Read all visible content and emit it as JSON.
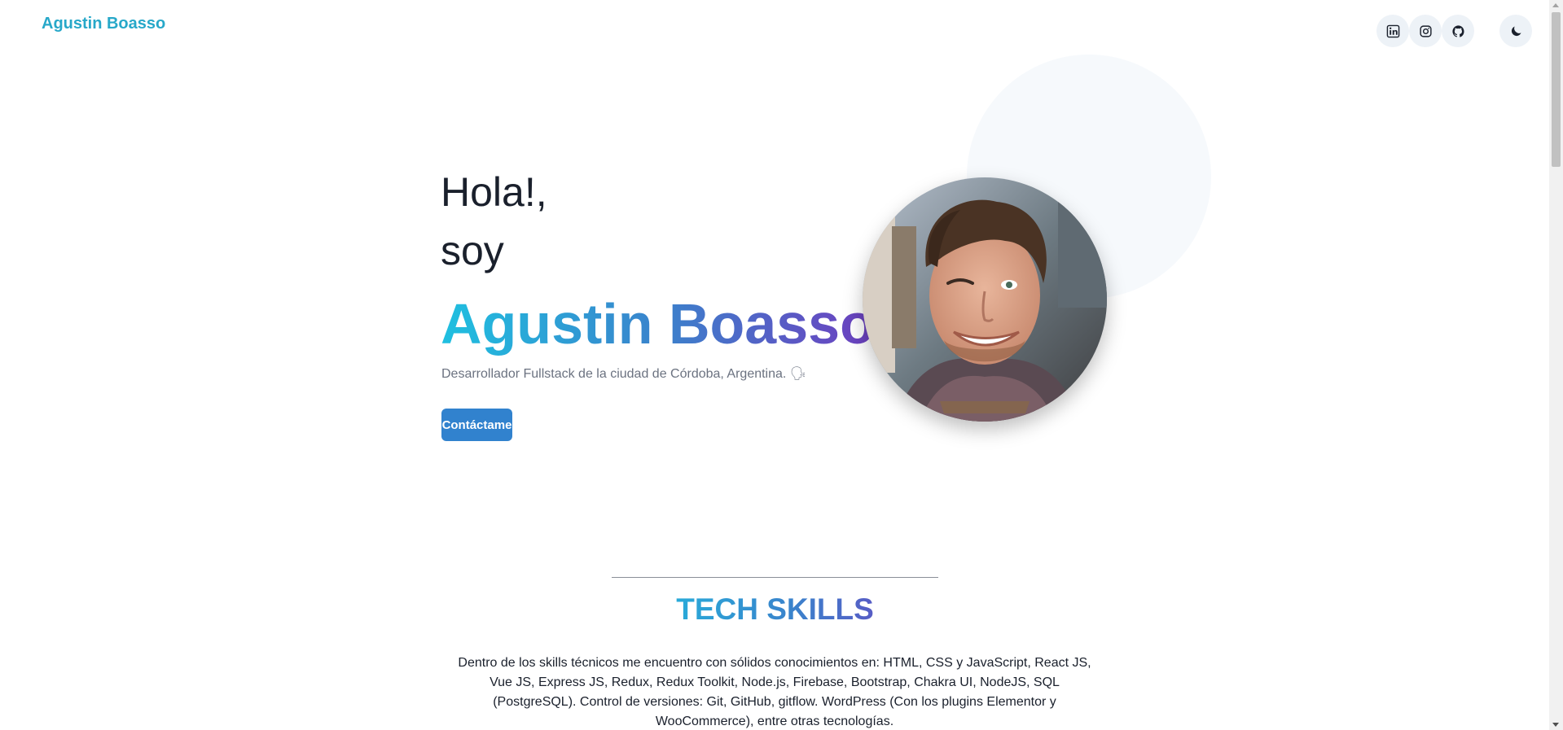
{
  "header": {
    "brand": "Agustin Boasso",
    "social_icons": [
      "linkedin-icon",
      "instagram-icon",
      "github-icon"
    ],
    "theme_toggle_icon": "moon-icon"
  },
  "hero": {
    "greeting_line1": "Hola!,",
    "greeting_line2": "soy",
    "name": "Agustin Boasso",
    "tagline": "Desarrollador Fullstack de la ciudad de Córdoba, Argentina. 🗣",
    "cta_label": "Contáctame",
    "avatar_icon": "profile-photo"
  },
  "skills": {
    "title": "TECH SKILLS",
    "text": "Dentro de los skills técnicos me encuentro con sólidos conocimientos en: HTML, CSS y JavaScript, React JS, Vue JS, Express JS, Redux, Redux Toolkit, Node.js, Firebase, Bootstrap, Chakra UI, NodeJS, SQL (PostgreSQL). Control de versiones: Git, GitHub, gitflow. WordPress (Con los plugins Elementor y WooCommerce), entre otras tecnologías."
  },
  "colors": {
    "brand": "#27a8c9",
    "button": "#3182ce",
    "gradient_start": "#1fc0e0",
    "gradient_end": "#6e3fc0"
  }
}
